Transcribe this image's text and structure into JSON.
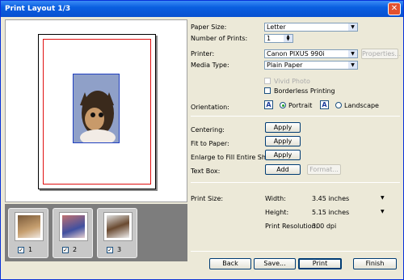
{
  "window": {
    "title": "Print Layout 1/3"
  },
  "thumbs": [
    {
      "num": "1",
      "checked": "✓"
    },
    {
      "num": "2",
      "checked": "✓"
    },
    {
      "num": "3",
      "checked": "✓"
    }
  ],
  "paper_size": {
    "label": "Paper Size:",
    "value": "Letter"
  },
  "num_prints": {
    "label": "Number of Prints:",
    "value": "1"
  },
  "printer": {
    "label": "Printer:",
    "value": "Canon PIXUS 990i",
    "properties": "Properties..."
  },
  "media_type": {
    "label": "Media Type:",
    "value": "Plain Paper"
  },
  "vivid_photo": "Vivid Photo",
  "borderless": "Borderless Printing",
  "orientation": {
    "label": "Orientation:",
    "portrait": "Portrait",
    "landscape": "Landscape",
    "icon_letter": "A"
  },
  "centering": {
    "label": "Centering:",
    "button": "Apply"
  },
  "fit_paper": {
    "label": "Fit to Paper:",
    "button": "Apply"
  },
  "enlarge": {
    "label": "Enlarge to Fill Entire Sheet:",
    "button": "Apply"
  },
  "text_box": {
    "label": "Text Box:",
    "add": "Add",
    "format": "Format..."
  },
  "print_size": {
    "label": "Print Size:",
    "width_label": "Width:",
    "width_value": "3.45 inches",
    "height_label": "Height:",
    "height_value": "5.15 inches"
  },
  "resolution": {
    "label": "Print Resolution:",
    "value": "300 dpi"
  },
  "footer": {
    "back": "Back",
    "save": "Save...",
    "print": "Print",
    "finish": "Finish"
  }
}
